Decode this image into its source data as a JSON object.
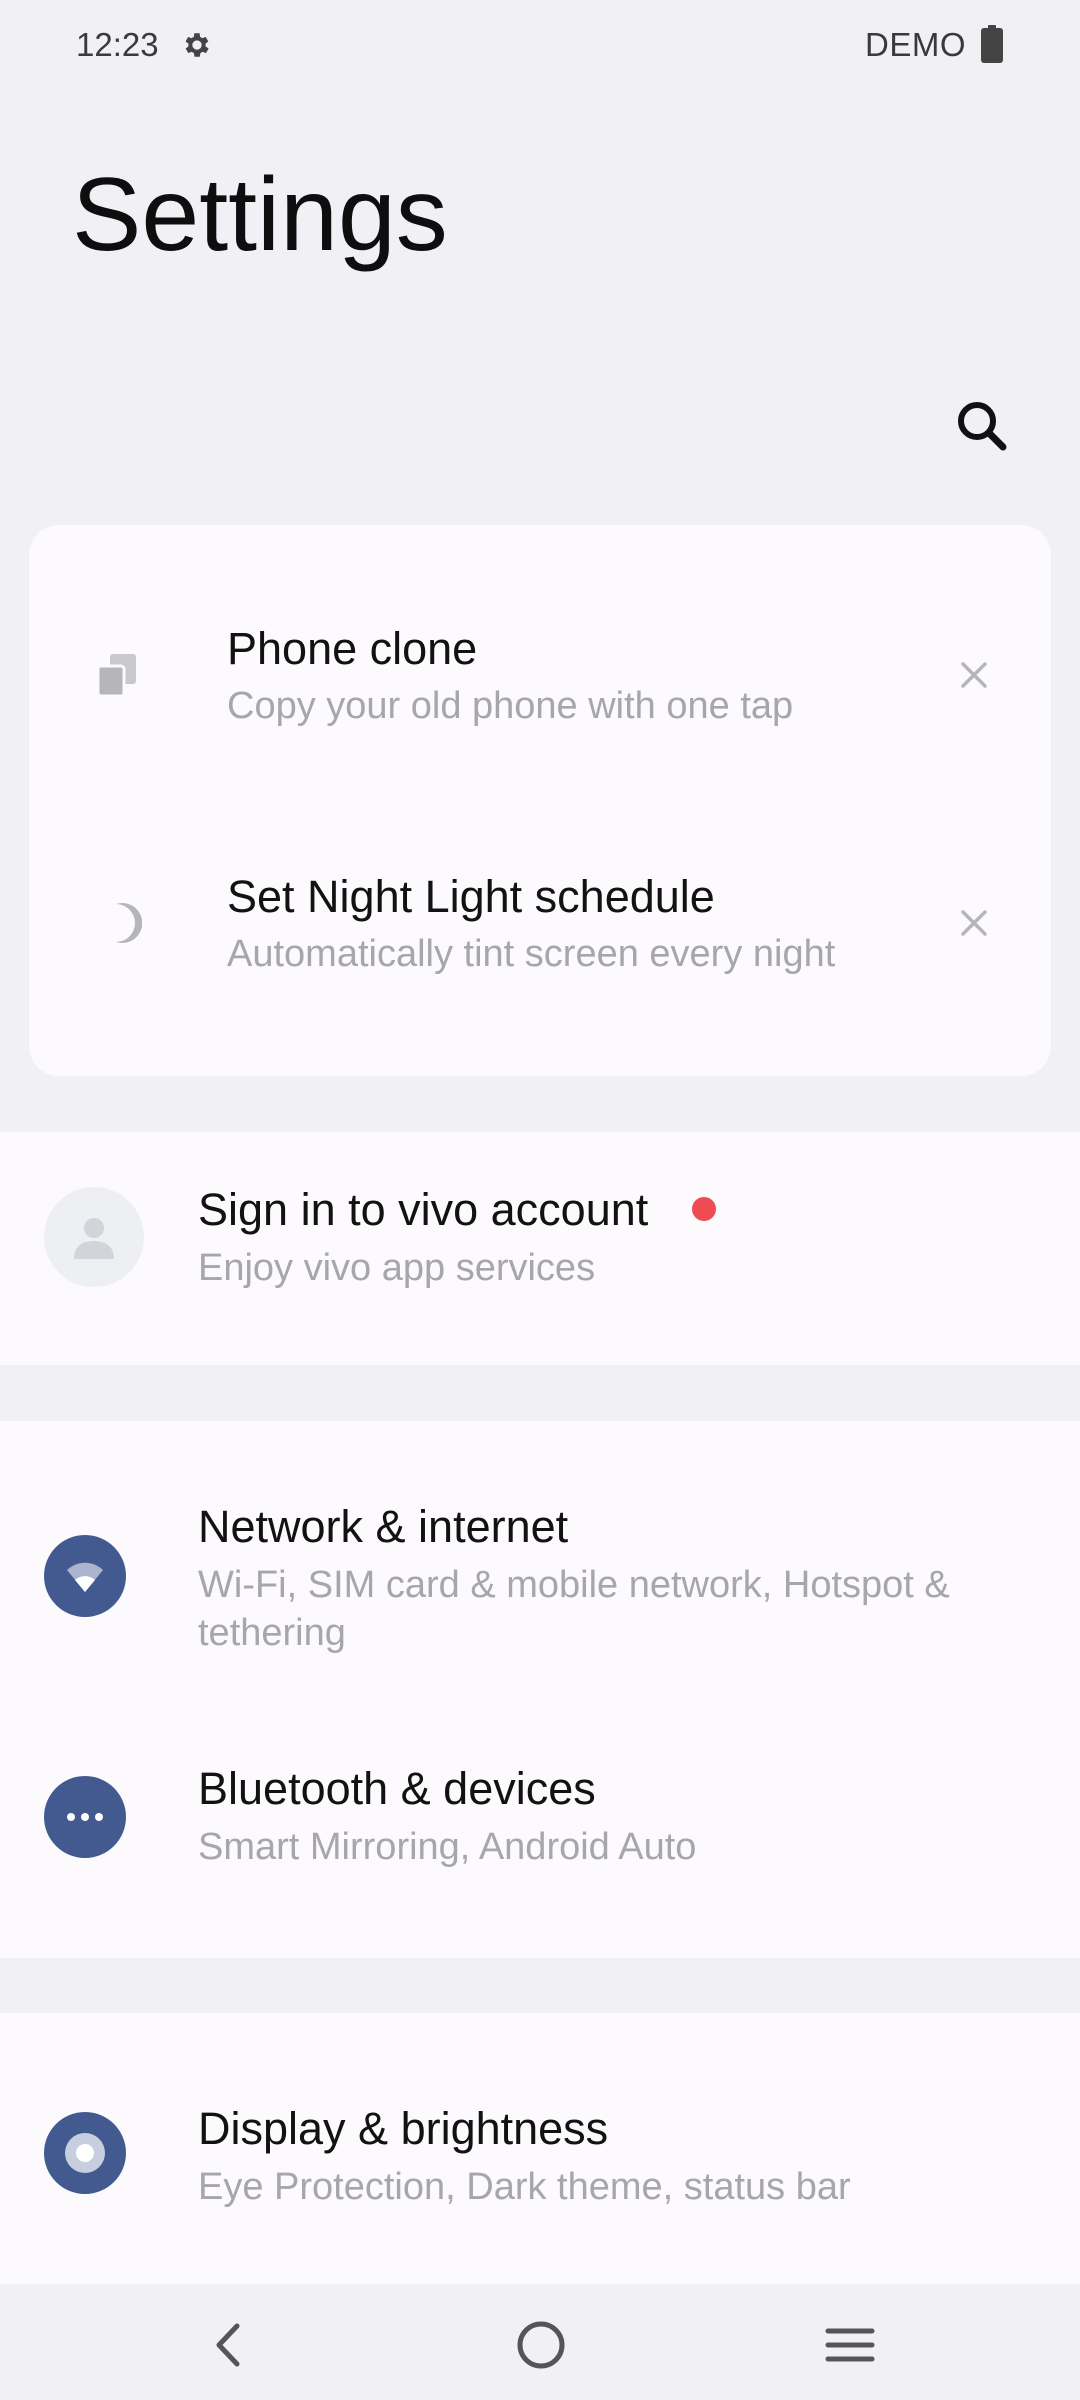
{
  "status_bar": {
    "time": "12:23",
    "carrier_label": "DEMO",
    "icons": [
      "gear-icon",
      "battery-icon"
    ]
  },
  "header": {
    "title": "Settings",
    "search_icon": "search-icon"
  },
  "suggestions": [
    {
      "title": "Phone clone",
      "subtitle": "Copy your old phone with one tap",
      "icon": "phone-clone-icon"
    },
    {
      "title": "Set Night Light schedule",
      "subtitle": "Automatically tint screen every night",
      "icon": "moon-icon"
    }
  ],
  "account": {
    "title": "Sign in to vivo account",
    "subtitle": "Enjoy vivo app services",
    "icon": "avatar-icon",
    "badge_color": "#EE4B53"
  },
  "connectivity": [
    {
      "title": "Network & internet",
      "subtitle": "Wi-Fi, SIM card & mobile network, Hotspot & tethering",
      "icon": "wifi-icon"
    },
    {
      "title": "Bluetooth & devices",
      "subtitle": "Smart Mirroring, Android Auto",
      "icon": "more-dots-icon"
    }
  ],
  "display": [
    {
      "title": "Display & brightness",
      "subtitle": "Eye Protection, Dark theme, status bar",
      "icon": "display-icon"
    }
  ],
  "colors": {
    "background": "#F1F0F5",
    "card": "#FCFAFD",
    "icon_accent": "#435A91",
    "subtitle": "#A6A6AB"
  },
  "nav_bar": {
    "icons": [
      "back-icon",
      "home-icon",
      "menu-icon"
    ]
  }
}
